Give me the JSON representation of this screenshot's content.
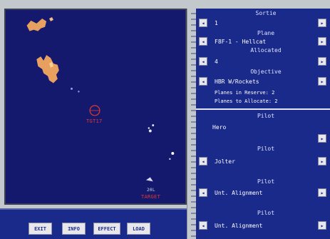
{
  "map": {
    "labels": {
      "target": "TGT17",
      "target2": "TARGET",
      "coord": "20L"
    }
  },
  "commands": [
    {
      "label": "EXIT"
    },
    {
      "label": "INFO"
    },
    {
      "label": "EFFECT"
    },
    {
      "label": "LOAD"
    }
  ],
  "sortie": {
    "title": "Sortie",
    "value": "1"
  },
  "plane": {
    "title": "Plane",
    "value": "F8F-1 - Hellcat",
    "status": "Allocated"
  },
  "count": {
    "value": "4"
  },
  "objective": {
    "title": "Objective",
    "value": "HBR W/Rockets"
  },
  "reserve": {
    "reserve_line": "Planes in Reserve: 2",
    "allocate_line": "Planes to Allocate: 2"
  },
  "pilots": [
    {
      "title": "Pilot",
      "value": "Hero"
    },
    {
      "title": "Pilot",
      "value": "Jolter"
    },
    {
      "title": "Pilot",
      "value": "Unt. Alignment"
    },
    {
      "title": "Pilot",
      "value": "Unt. Alignment"
    }
  ],
  "colors": {
    "map_bg": "#14196e",
    "panel_bg": "#1a2a8a",
    "terrain": "#e8a060",
    "target_marker": "#e03a2e"
  }
}
